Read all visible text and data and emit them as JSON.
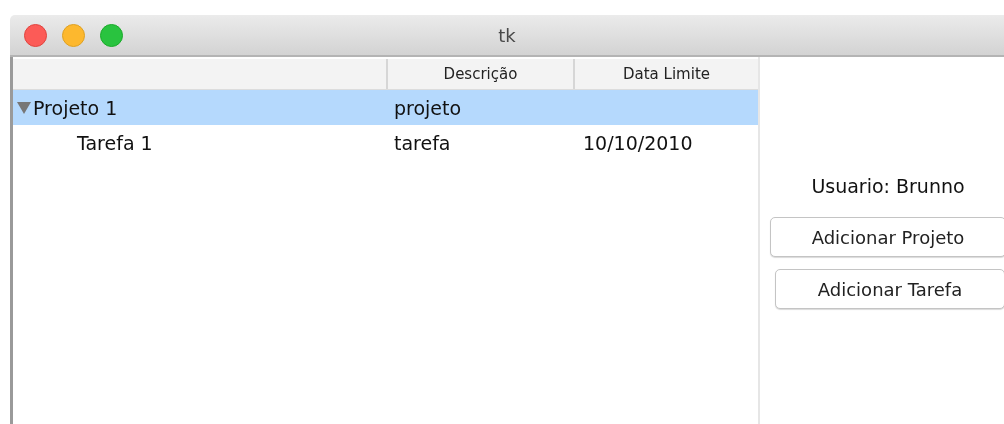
{
  "window": {
    "title": "tk"
  },
  "tree": {
    "columns": [
      "Descrição",
      "Data Limite"
    ],
    "rows": [
      {
        "label": "Projeto 1",
        "description": "projeto",
        "selected": true,
        "expanded": true,
        "children": [
          {
            "label": "Tarefa 1",
            "description": "tarefa",
            "deadline": "10/10/2010",
            "selected": false
          }
        ]
      }
    ]
  },
  "side": {
    "user_label": "Usuario: Brunno",
    "buttons": [
      "Adicionar Projeto",
      "Adicionar Tarefa"
    ]
  }
}
